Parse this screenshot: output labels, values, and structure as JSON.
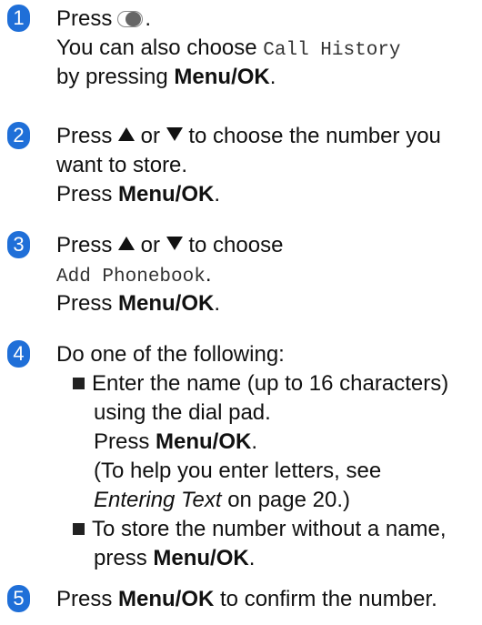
{
  "steps": [
    {
      "number": "1",
      "lines": [
        {
          "a": "Press",
          "icon": "call-key-icon",
          "b": "."
        },
        {
          "a": "You can also choose ",
          "mono": "Call History"
        },
        {
          "a": "by pressing ",
          "bold": "Menu/OK",
          "b": "."
        }
      ]
    },
    {
      "number": "2",
      "lines": [
        {
          "a": "Press ",
          "b": " or ",
          "c": " to choose the number you"
        },
        {
          "a": "want to store."
        },
        {
          "a": "Press ",
          "bold": "Menu/OK",
          "b": "."
        }
      ]
    },
    {
      "number": "3",
      "lines": [
        {
          "a": "Press ",
          "b": " or ",
          "c": " to choose"
        },
        {
          "mono": "Add Phonebook",
          "b": "."
        },
        {
          "a": "Press ",
          "bold": "Menu/OK",
          "b": "."
        }
      ]
    },
    {
      "number": "4",
      "intro": "Do one of the following:",
      "bullets": [
        {
          "l1": "Enter the name (up to 16 characters)",
          "l2": "using the dial pad.",
          "l3a": "Press ",
          "l3bold": "Menu/OK",
          "l3b": ".",
          "l4": "(To help you enter letters, see",
          "l5italic": "Entering Text",
          "l5b": " on page 20.)"
        },
        {
          "l1": "To store the number without a name,",
          "l2a": "press ",
          "l2bold": "Menu/OK",
          "l2b": "."
        }
      ]
    },
    {
      "number": "5",
      "lines": [
        {
          "a": "Press ",
          "bold": "Menu/OK",
          "b": " to confirm the number."
        }
      ]
    }
  ]
}
